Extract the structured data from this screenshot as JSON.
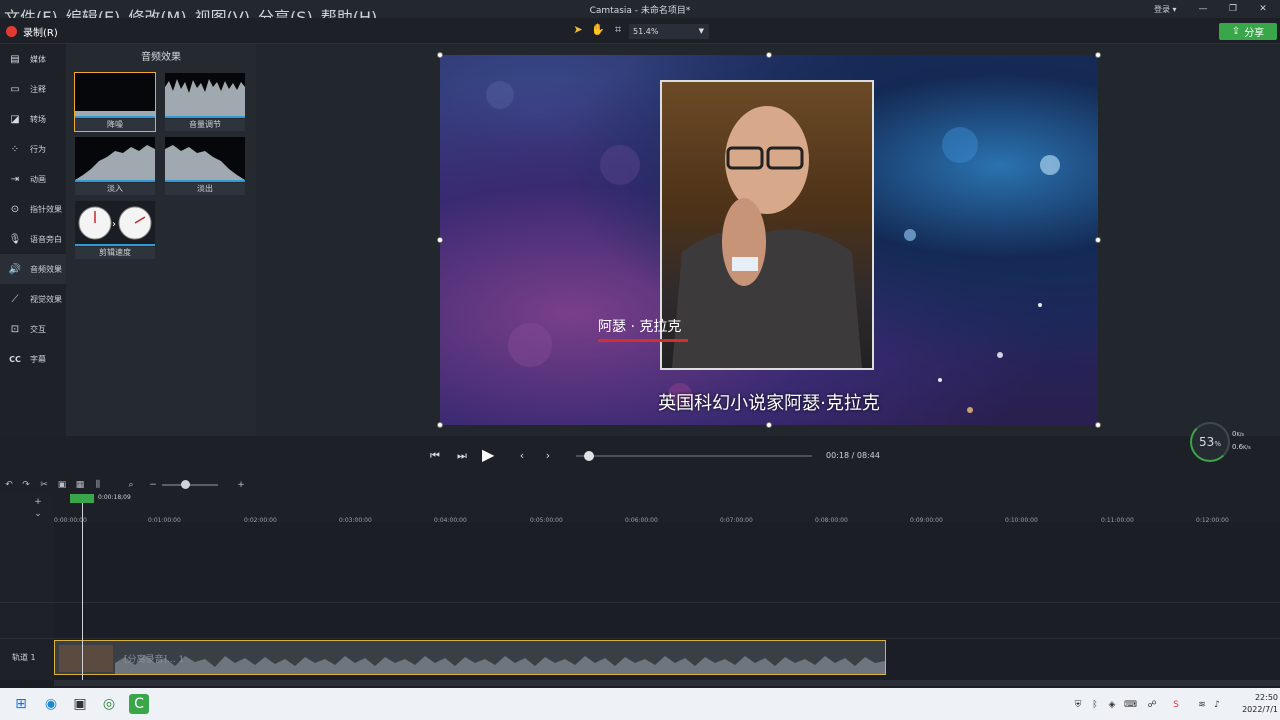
{
  "window": {
    "title": "Camtasia - 未命名项目*",
    "menu": [
      "文件(F)",
      "编辑(E)",
      "修改(M)",
      "视图(V)",
      "分享(S)",
      "帮助(H)"
    ],
    "login": "登录 ▾",
    "controls": [
      "—",
      "❐",
      "✕"
    ]
  },
  "toolbar": {
    "record_label": "录制(R)",
    "zoom_value": "51.4%",
    "share_label": "分享"
  },
  "sidebar": {
    "items": [
      {
        "label": "媒体",
        "icon": "film-icon"
      },
      {
        "label": "注释",
        "icon": "annotation-icon"
      },
      {
        "label": "转场",
        "icon": "transition-icon"
      },
      {
        "label": "行为",
        "icon": "behavior-icon"
      },
      {
        "label": "动画",
        "icon": "animation-icon"
      },
      {
        "label": "指针效果",
        "icon": "cursor-icon"
      },
      {
        "label": "语音旁白",
        "icon": "microphone-icon"
      },
      {
        "label": "音频效果",
        "icon": "speaker-icon",
        "active": true
      },
      {
        "label": "视觉效果",
        "icon": "wand-icon"
      },
      {
        "label": "交互",
        "icon": "interactive-icon"
      },
      {
        "label": "字幕",
        "icon": "cc-icon"
      }
    ]
  },
  "effects_panel": {
    "title": "音频效果",
    "items": [
      {
        "label": "降噪",
        "selected": true
      },
      {
        "label": "音量调节"
      },
      {
        "label": "淡入"
      },
      {
        "label": "淡出"
      },
      {
        "label": "剪辑速度"
      }
    ]
  },
  "canvas": {
    "name_caption": "阿瑟 · 克拉克",
    "subtitle": "英国科幻小说家阿瑟·克拉克"
  },
  "playback": {
    "current_time": "00:18",
    "separator": "/",
    "total_time": "08:44",
    "progress": 0.035
  },
  "perf": {
    "percent": "53",
    "percent_unit": "%",
    "upload": "0",
    "upload_unit": "K/s",
    "download": "0.6",
    "download_unit": "K/s"
  },
  "timeline": {
    "playhead_time": "0:00:18;09",
    "ruler_labels": [
      "0:00:00;00",
      "0:01:00;00",
      "0:02:00;00",
      "0:03:00;00",
      "0:04:00;00",
      "0:05:00;00",
      "0:06:00;00",
      "0:07:00;00",
      "0:08:00;00",
      "0:09:00;00",
      "0:10:00;00",
      "0:11:00;00",
      "0:12:00;00"
    ],
    "track_label": "轨道 1",
    "clip_name": "[分离录音]... 1"
  },
  "taskbar": {
    "time": "22:50",
    "date": "2022/7/1"
  },
  "colors": {
    "accent_green": "#3aa64a",
    "record_red": "#e53935",
    "selection_orange": "#f0a830",
    "clip_border": "#d8b23a"
  }
}
